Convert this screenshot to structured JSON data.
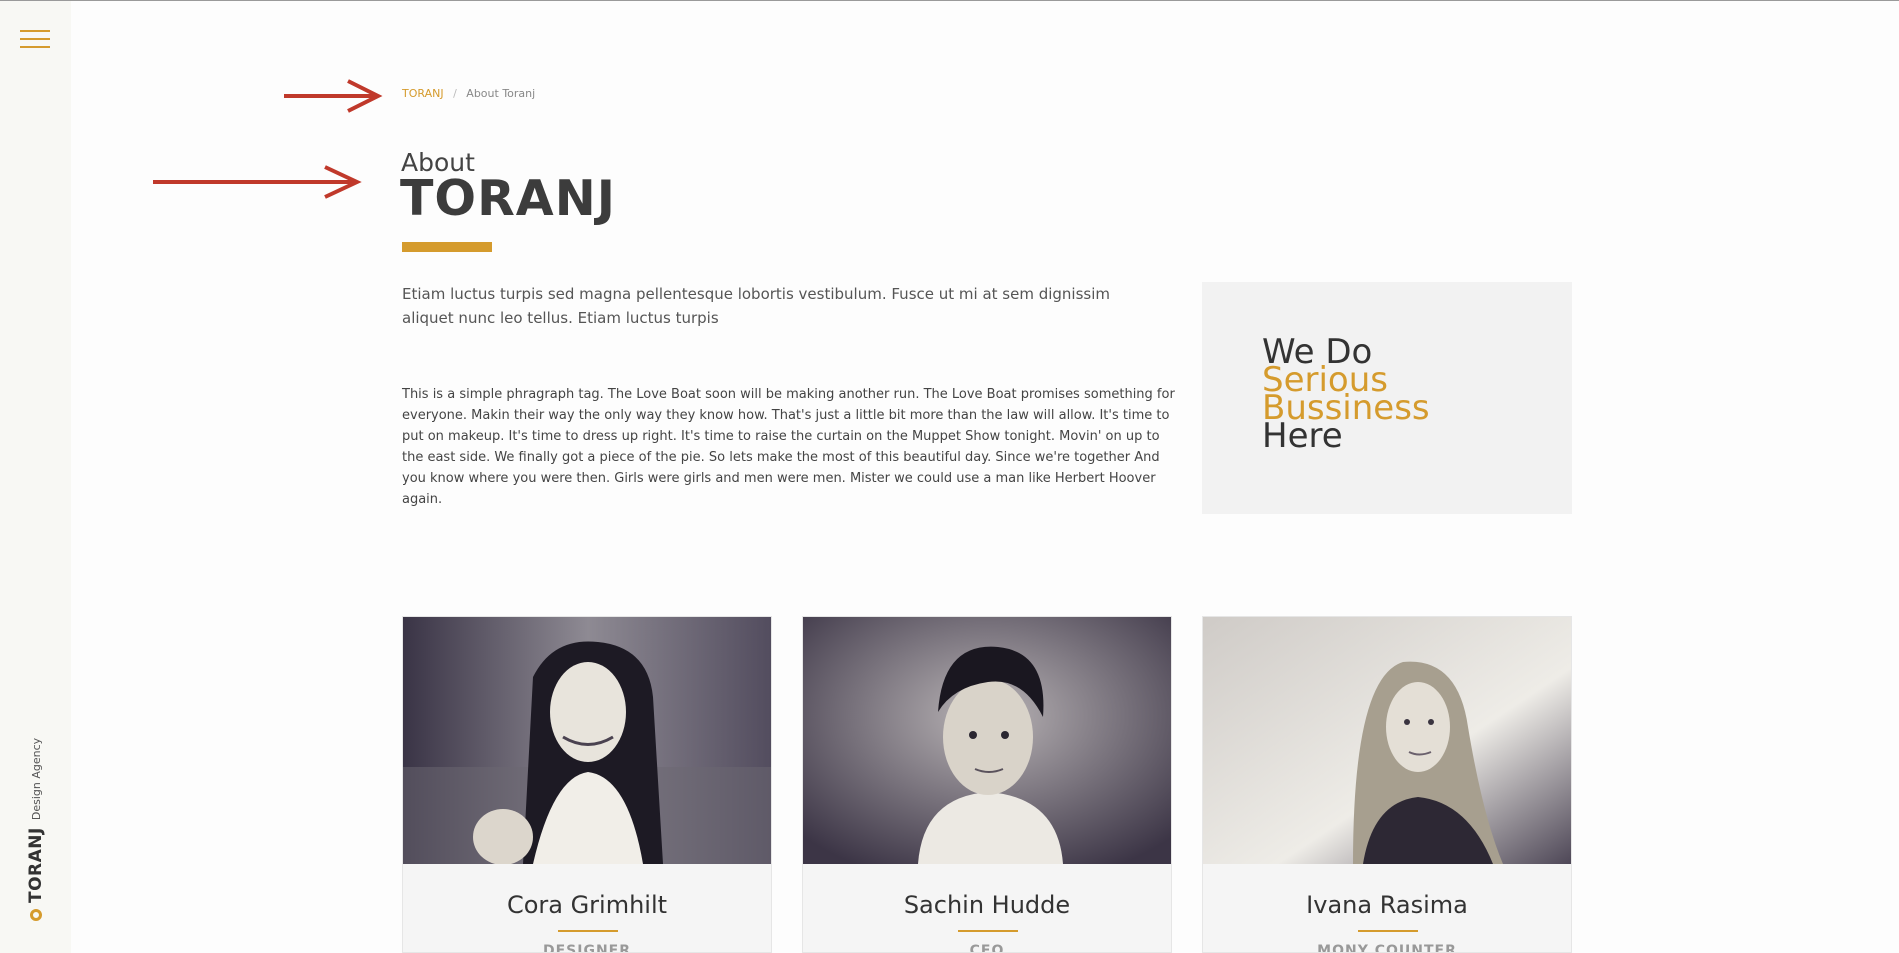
{
  "sidebar": {
    "menu_icon": "hamburger-icon",
    "brand_name": "TORANJ",
    "brand_tagline": "Design Agency"
  },
  "breadcrumb": {
    "root": "TORANJ",
    "separator": "/",
    "current": "About Toranj"
  },
  "page_title": {
    "small": "About",
    "big": "TORANJ"
  },
  "intro": {
    "lead": "Etiam luctus turpis sed magna pellentesque lobortis vestibulum. Fusce ut mi at sem dignissim aliquet nunc leo tellus. Etiam luctus turpis",
    "body": "This is a simple phragraph tag. The Love Boat soon will be making another run. The Love Boat promises something for everyone. Makin their way the only way they know how. That's just a little bit more than the law will allow. It's time to put on makeup. It's time to dress up right. It's time to raise the curtain on the Muppet Show tonight. Movin' on up to the east side. We finally got a piece of the pie. So lets make the most of this beautiful day. Since we're together And you know where you were then. Girls were girls and men were men. Mister we could use a man like Herbert Hoover again."
  },
  "slogan": {
    "line1": "We Do",
    "line2": "Serious",
    "line3": "Bussiness",
    "line4": "Here"
  },
  "team": [
    {
      "name": "Cora Grimhilt",
      "role": "DESIGNER"
    },
    {
      "name": "Sachin Hudde",
      "role": "CEO"
    },
    {
      "name": "Ivana Rasima",
      "role": "MONY COUNTER"
    }
  ],
  "colors": {
    "accent": "#d59b2d",
    "arrow": "#c0392b"
  }
}
